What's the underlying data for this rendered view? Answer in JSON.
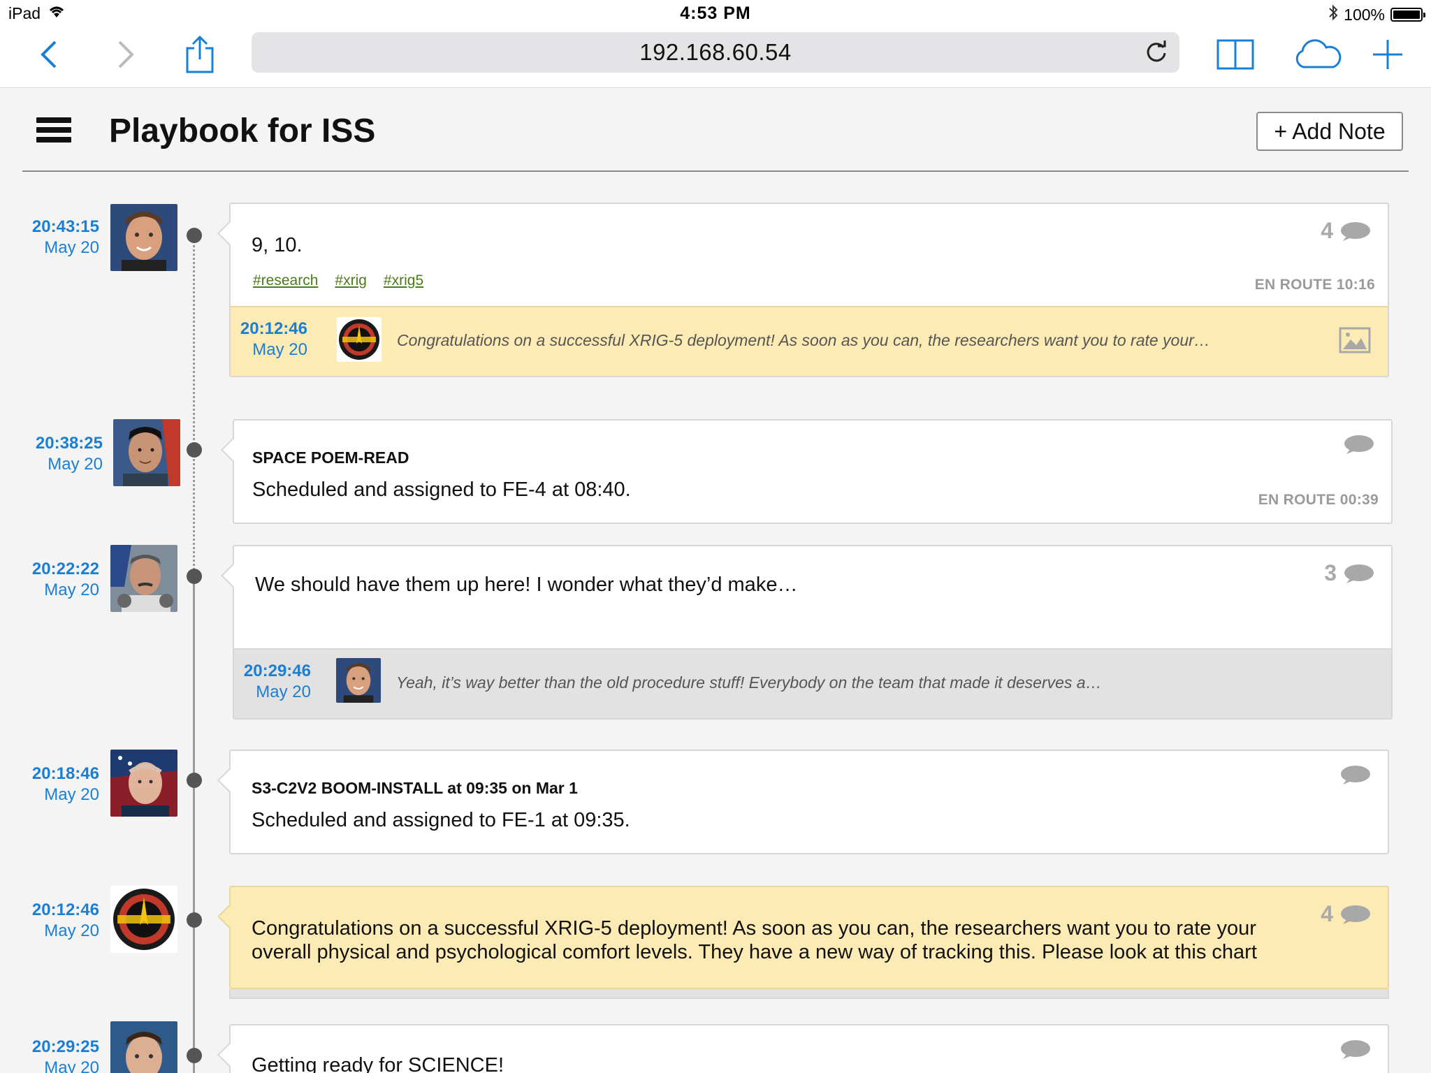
{
  "status_bar": {
    "device": "iPad",
    "time": "4:53 PM",
    "battery": "100%"
  },
  "browser": {
    "url": "192.168.60.54"
  },
  "app": {
    "title": "Playbook for ISS",
    "add_note_label": "+ Add Note"
  },
  "entries": [
    {
      "time": "20:43:15",
      "date": "May 20",
      "avatar": "astronaut-1",
      "text": "9, 10.",
      "tags": [
        "#research",
        "#xrig",
        "#xrig5"
      ],
      "comments": "4",
      "enroute": "EN ROUTE 10:16",
      "reply": {
        "time": "20:12:46",
        "date": "May 20",
        "avatar": "flight-ops-logo",
        "text": "Congratulations on a successful XRIG-5 deployment! As soon as you can, the researchers want you to rate your…",
        "icon": "image-icon"
      }
    },
    {
      "time": "20:38:25",
      "date": "May 20",
      "avatar": "astronaut-2",
      "heading": "SPACE POEM-READ",
      "text": "Scheduled and assigned to FE-4 at 08:40.",
      "comments": "",
      "enroute": "EN ROUTE 00:39"
    },
    {
      "time": "20:22:22",
      "date": "May 20",
      "avatar": "astronaut-3",
      "text": "We should have them up here! I wonder what they’d make…",
      "comments": "3",
      "reply": {
        "time": "20:29:46",
        "date": "May 20",
        "avatar": "astronaut-1",
        "text": "Yeah, it’s way better than the old procedure stuff! Everybody on the team that made it deserves a…"
      }
    },
    {
      "time": "20:18:46",
      "date": "May 20",
      "avatar": "astronaut-4",
      "heading": "S3-C2V2 BOOM-INSTALL at 09:35 on Mar 1",
      "text": "Scheduled and assigned to FE-1 at 09:35.",
      "comments": ""
    },
    {
      "time": "20:12:46",
      "date": "May 20",
      "avatar": "flight-ops-logo",
      "text_line1": "Congratulations on a successful XRIG-5 deployment! As soon as you can, the researchers want you to rate your",
      "text_line2": "overall physical and psychological comfort levels. They have a new way of tracking this. Please look at this chart",
      "comments": "4"
    },
    {
      "time": "20:29:25",
      "date": "May 20",
      "avatar": "astronaut-5",
      "text": "Getting ready for SCIENCE!",
      "comments": ""
    }
  ],
  "colors": {
    "timestamp": "#1a7fd4",
    "tag": "#4d7a1d",
    "highlight": "#fcebb4",
    "ios_blue": "#1a7fd4"
  }
}
